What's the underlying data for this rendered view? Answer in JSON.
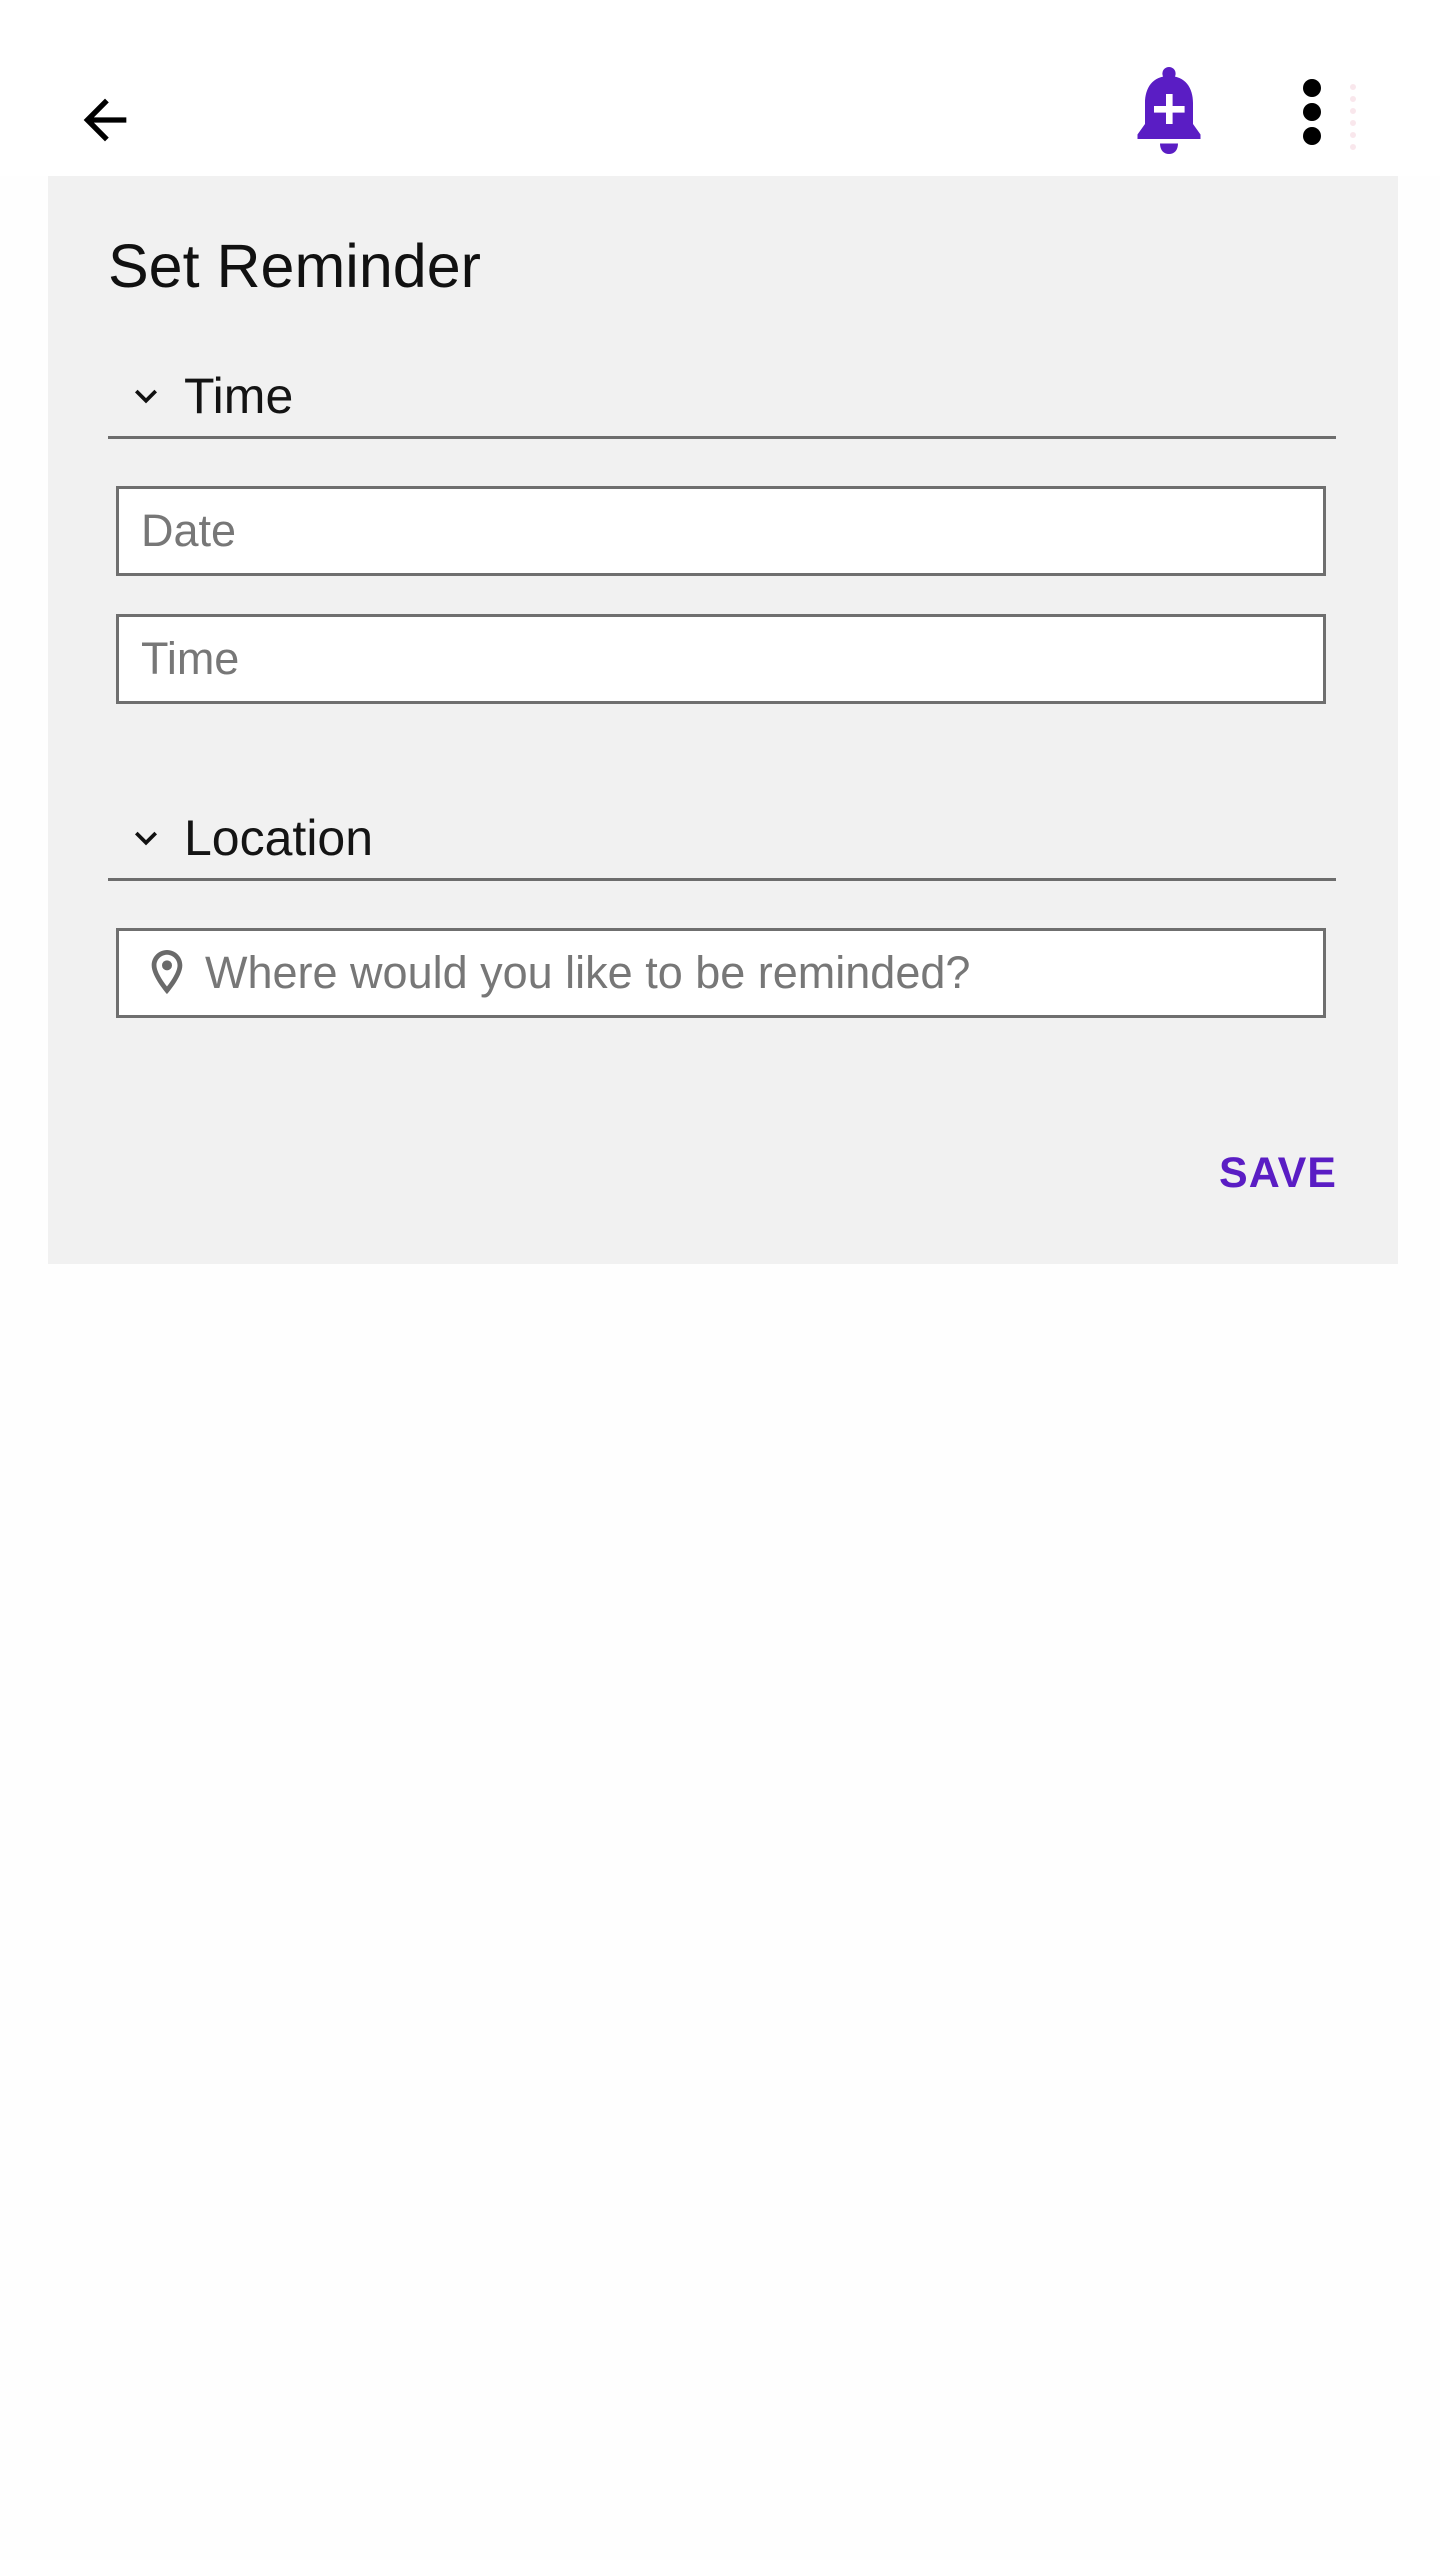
{
  "toolbar": {
    "back_icon": "arrow-left-icon",
    "reminder_icon": "bell-plus-icon",
    "more_icon": "more-vertical-icon",
    "accent_color": "#5a1dc4"
  },
  "card": {
    "title": "Set Reminder",
    "time_section": {
      "label": "Time",
      "icon": "chevron-down-icon",
      "date_placeholder": "Date",
      "time_placeholder": "Time"
    },
    "location_section": {
      "label": "Location",
      "icon": "chevron-down-icon",
      "location_icon": "location-pin-icon",
      "location_placeholder": "Where would you like to be reminded?"
    },
    "save_label": "SAVE"
  }
}
